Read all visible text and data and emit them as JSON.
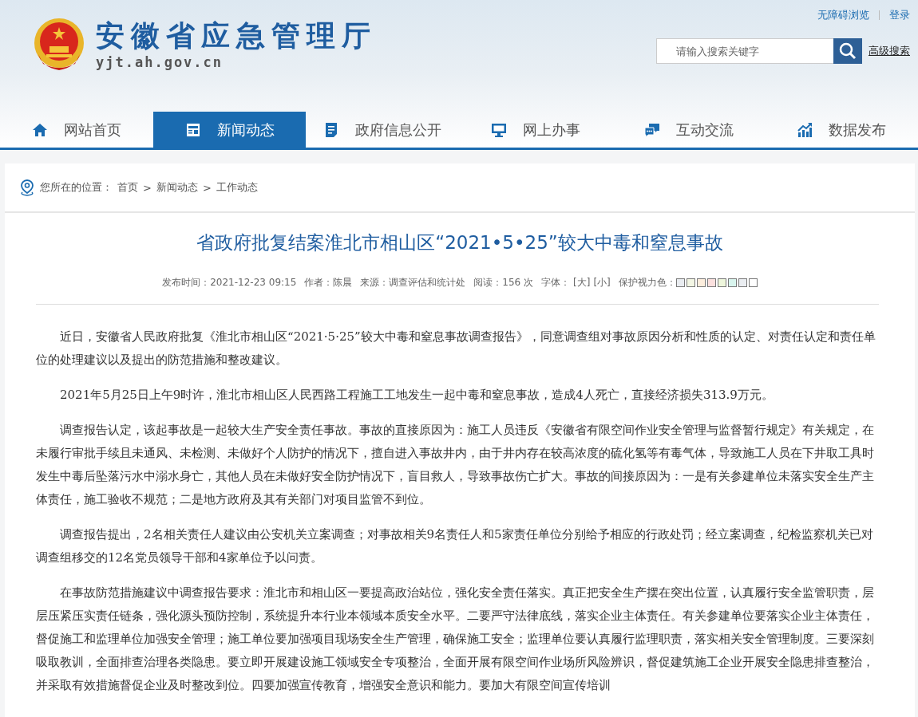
{
  "header": {
    "site_title": "安徽省应急管理厅",
    "site_domain": "yjt.ah.gov.cn",
    "top_links": [
      "无障碍浏览",
      "登录"
    ],
    "search": {
      "placeholder": "请输入搜索关键字"
    },
    "advanced_search": "高级搜索"
  },
  "nav": [
    {
      "label": "网站首页",
      "selected": false
    },
    {
      "label": "新闻动态",
      "selected": true
    },
    {
      "label": "政府信息公开",
      "selected": false
    },
    {
      "label": "网上办事",
      "selected": false
    },
    {
      "label": "互动交流",
      "selected": false
    },
    {
      "label": "数据发布",
      "selected": false
    }
  ],
  "breadcrumb": {
    "prefix": "您所在的位置：",
    "items": [
      "首页",
      "新闻动态",
      "工作动态"
    ],
    "separator": ">"
  },
  "article": {
    "title": "省政府批复结案淮北市相山区“2021•5•25”较大中毒和窒息事故",
    "meta": [
      "发布时间：2021-12-23 09:15",
      "作者：陈晨",
      "来源：调查评估和统计处",
      "阅读：156 次"
    ],
    "font_label": "字体：",
    "font_sizes": [
      "[大]",
      "[小]"
    ],
    "eye_color_label": "保护视力色：",
    "eye_colors": [
      {
        "color": "#e9ecf0"
      },
      {
        "color": "#f3f6e4"
      },
      {
        "color": "#fdeedd"
      },
      {
        "color": "#fbe0de"
      },
      {
        "color": "#eef6dc"
      },
      {
        "color": "#d9f5ee"
      },
      {
        "color": "#eaedf1"
      },
      {
        "color": "#ffffff"
      }
    ],
    "paragraphs": [
      "近日，安徽省人民政府批复《淮北市相山区“2021·5·25”较大中毒和窒息事故调查报告》，同意调查组对事故原因分析和性质的认定、对责任认定和责任单位的处理建议以及提出的防范措施和整改建议。",
      "2021年5月25日上午9时许，淮北市相山区人民西路工程施工工地发生一起中毒和窒息事故，造成4人死亡，直接经济损失313.9万元。",
      "调查报告认定，该起事故是一起较大生产安全责任事故。事故的直接原因为：施工人员违反《安徽省有限空间作业安全管理与监督暂行规定》有关规定，在未履行审批手续且未通风、未检测、未做好个人防护的情况下，擅自进入事故井内，由于井内存在较高浓度的硫化氢等有毒气体，导致施工人员在下井取工具时发生中毒后坠落污水中溺水身亡，其他人员在未做好安全防护情况下，盲目救人，导致事故伤亡扩大。事故的间接原因为：一是有关参建单位未落实安全生产主体责任，施工验收不规范；二是地方政府及其有关部门对项目监管不到位。",
      "调查报告提出，2名相关责任人建议由公安机关立案调查；对事故相关9名责任人和5家责任单位分别给予相应的行政处罚；经立案调查，纪检监察机关已对调查组移交的12名党员领导干部和4家单位予以问责。",
      "在事故防范措施建议中调查报告要求：淮北市和相山区一要提高政治站位，强化安全责任落实。真正把安全生产摆在突出位置，认真履行安全监管职责，层层压紧压实责任链条，强化源头预防控制，系统提升本行业本领域本质安全水平。二要严守法律底线，落实企业主体责任。有关参建单位要落实企业主体责任，督促施工和监理单位加强安全管理；施工单位要加强项目现场安全生产管理，确保施工安全；监理单位要认真履行监理职责，落实相关安全管理制度。三要深刻吸取教训，全面排查治理各类隐患。要立即开展建设施工领域安全专项整治，全面开展有限空间作业场所风险辨识，督促建筑施工企业开展安全隐患排查整治，并采取有效措施督促企业及时整改到位。四要加强宣传教育，增强安全意识和能力。要加大有限空间宣传培训"
    ]
  }
}
